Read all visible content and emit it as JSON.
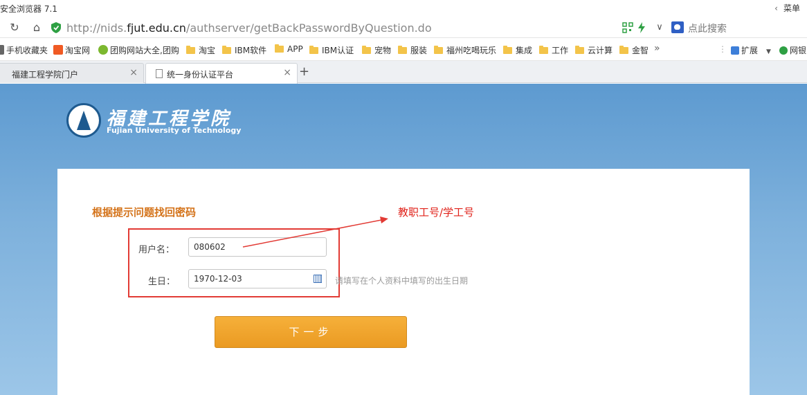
{
  "browser": {
    "app_title": "安全浏览器 7.1",
    "menu_label": "菜单",
    "url_prefix": "http://nids.",
    "url_domain": "fjut.edu.cn",
    "url_path": "/authserver/getBackPasswordByQuestion.do",
    "search_placeholder": "点此搜索"
  },
  "bookmarks": [
    {
      "label": "手机收藏夹"
    },
    {
      "label": "淘宝网"
    },
    {
      "label": "团购网站大全,团购"
    },
    {
      "label": "淘宝"
    },
    {
      "label": "IBM软件"
    },
    {
      "label": "APP"
    },
    {
      "label": "IBM认证"
    },
    {
      "label": "宠物"
    },
    {
      "label": "服装"
    },
    {
      "label": "福州吃喝玩乐"
    },
    {
      "label": "集成"
    },
    {
      "label": "工作"
    },
    {
      "label": "云计算"
    },
    {
      "label": "金智"
    }
  ],
  "bookmarks_more": "»",
  "extensions_label": "扩展",
  "bank_label": "网银",
  "tabs": [
    {
      "label": "福建工程学院门户"
    },
    {
      "label": "统一身份认证平台"
    }
  ],
  "logo": {
    "cn": "福建工程学院",
    "en": "Fujian University of Technology"
  },
  "form": {
    "title": "根据提示问题找回密码",
    "note": "教职工号/学工号",
    "username_label": "用户名：",
    "username_value": "080602",
    "birthday_label": "生日：",
    "birthday_value": "1970-12-03",
    "birthday_hint": "请填写在个人资料中填写的出生日期",
    "next_button": "下一步"
  },
  "colors": {
    "accent_orange": "#ea9a22",
    "title_orange": "#d4731a",
    "annotation_red": "#e23a34",
    "page_blue": "#7eb1dc"
  }
}
